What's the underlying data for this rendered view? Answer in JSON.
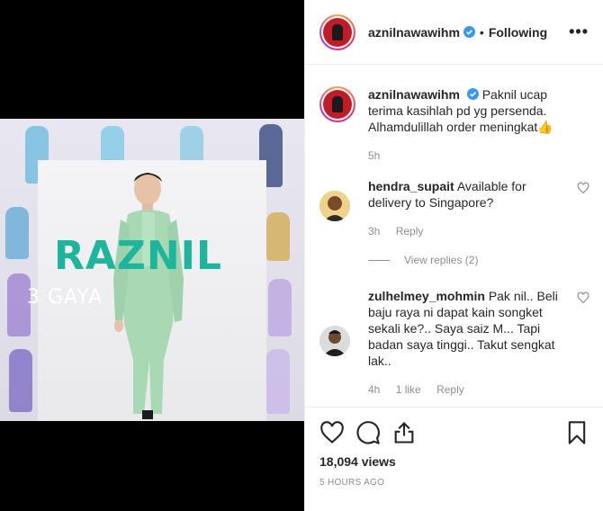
{
  "media": {
    "headline": "RAZNIL",
    "subline": "3 GAYA"
  },
  "post": {
    "username": "aznilnawawihm",
    "follow_separator": "•",
    "follow_label": "Following",
    "more_label": "•••"
  },
  "caption": {
    "username": "aznilnawawihm",
    "text": "Paknil ucap terima kasihlah pd yg persenda. Alhamdulillah order meningkat👍",
    "time": "5h"
  },
  "comments": [
    {
      "username": "hendra_supait",
      "text": "Available for delivery to Singapore?",
      "time": "3h",
      "likes": "",
      "reply_label": "Reply"
    },
    {
      "username": "zulhelmey_mohmin",
      "text": "Pak nil.. Beli baju raya ni dapat kain songket sekali ke?.. Saya saiz M... Tapi badan saya tinggi.. Takut sengkat lak..",
      "time": "4h",
      "likes": "1 like",
      "reply_label": "Reply"
    }
  ],
  "view_replies_label": "View replies (2)",
  "stats": {
    "views": "18,094 views",
    "posted_ago": "5 HOURS AGO"
  },
  "colors": {
    "headline": "#1fb59c",
    "verified": "#3897f0",
    "muted": "#8e8e8e"
  },
  "icons": [
    "heart-icon",
    "comment-icon",
    "share-icon",
    "bookmark-icon",
    "verified-badge-icon",
    "like-small-icon",
    "more-options-icon"
  ]
}
